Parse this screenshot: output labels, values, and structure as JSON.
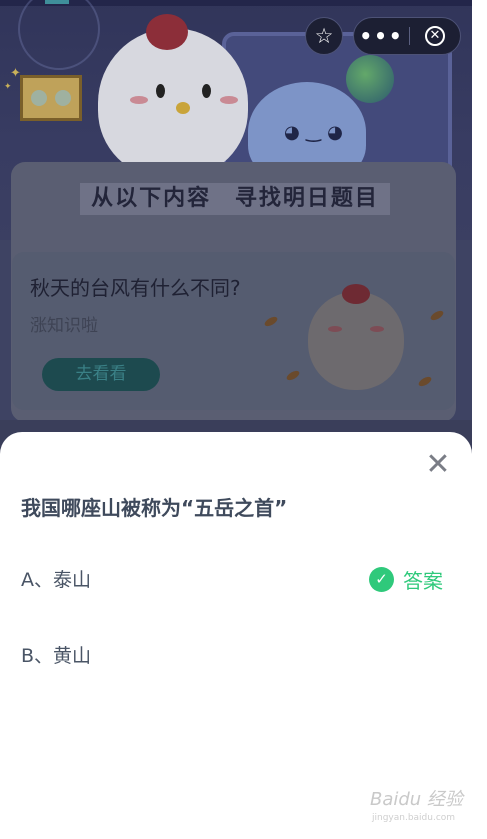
{
  "toolbar": {
    "favorite_icon": "star-outline-icon",
    "more_label": "•••",
    "close_icon": "close-circle-icon"
  },
  "banner": {
    "title": "从以下内容 寻找明日题目"
  },
  "article": {
    "title": "秋天的台风有什么不同?",
    "subtitle": "涨知识啦",
    "button_label": "去看看"
  },
  "quiz": {
    "question": "我国哪座山被称为“五岳之首”",
    "options": [
      {
        "label": "A、泰山",
        "is_answer": true
      },
      {
        "label": "B、黄山",
        "is_answer": false
      }
    ],
    "answer_label": "答案",
    "answer_color": "#2fc97b"
  },
  "watermark": {
    "text": "Baidu 经验",
    "sub": "jingyan.baidu.com"
  },
  "colors": {
    "accent_green": "#2fc97b",
    "text_dark": "#3f4a5c"
  }
}
